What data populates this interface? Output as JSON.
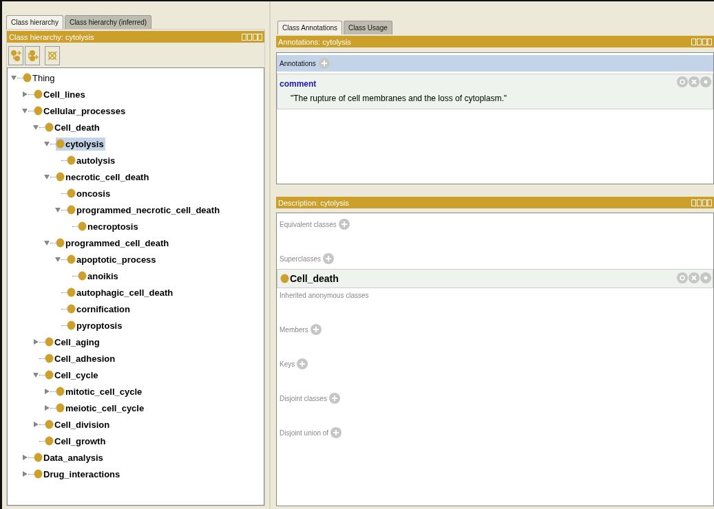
{
  "left_tabs": [
    {
      "label": "Class hierarchy",
      "selected": true
    },
    {
      "label": "Class hierarchy (inferred)",
      "selected": false
    }
  ],
  "hierarchy_view": {
    "title": "Class hierarchy: cytolysis",
    "tree": [
      {
        "label": "Thing",
        "expanded": true,
        "selected": false,
        "children": [
          {
            "label": "Cell_lines",
            "expanded": false,
            "selected": false
          },
          {
            "label": "Cellular_processes",
            "expanded": true,
            "selected": false,
            "children": [
              {
                "label": "Cell_death",
                "expanded": true,
                "selected": false,
                "children": [
                  {
                    "label": "cytolysis",
                    "expanded": true,
                    "selected": true,
                    "children": [
                      {
                        "label": "autolysis",
                        "selected": false
                      }
                    ]
                  },
                  {
                    "label": "necrotic_cell_death",
                    "expanded": true,
                    "selected": false,
                    "children": [
                      {
                        "label": "oncosis",
                        "selected": false
                      },
                      {
                        "label": "programmed_necrotic_cell_death",
                        "expanded": true,
                        "selected": false,
                        "children": [
                          {
                            "label": "necroptosis",
                            "selected": false
                          }
                        ]
                      }
                    ]
                  },
                  {
                    "label": "programmed_cell_death",
                    "expanded": true,
                    "selected": false,
                    "children": [
                      {
                        "label": "apoptotic_process",
                        "expanded": true,
                        "selected": false,
                        "children": [
                          {
                            "label": "anoikis",
                            "selected": false
                          }
                        ]
                      },
                      {
                        "label": "autophagic_cell_death",
                        "selected": false
                      },
                      {
                        "label": "cornification",
                        "selected": false
                      },
                      {
                        "label": "pyroptosis",
                        "selected": false
                      }
                    ]
                  }
                ]
              },
              {
                "label": "Cell_aging",
                "expanded": false,
                "selected": false
              },
              {
                "label": "Cell_adhesion",
                "selected": false
              },
              {
                "label": "Cell_cycle",
                "expanded": true,
                "selected": false,
                "children": [
                  {
                    "label": "mitotic_cell_cycle",
                    "expanded": false,
                    "selected": false
                  },
                  {
                    "label": "meiotic_cell_cycle",
                    "expanded": false,
                    "selected": false
                  }
                ]
              },
              {
                "label": "Cell_division",
                "expanded": false,
                "selected": false
              },
              {
                "label": "Cell_growth",
                "selected": false
              }
            ]
          },
          {
            "label": "Data_analysis",
            "expanded": false,
            "selected": false
          },
          {
            "label": "Drug_interactions",
            "expanded": false,
            "selected": false
          }
        ]
      }
    ]
  },
  "right_tabs": [
    {
      "label": "Class Annotations",
      "selected": true
    },
    {
      "label": "Class Usage",
      "selected": false
    }
  ],
  "annotations_view": {
    "title": "Annotations: cytolysis",
    "header": "Annotations",
    "items": [
      {
        "property": "comment",
        "value": "\"The rupture of cell membranes and the loss of cytoplasm.\""
      }
    ]
  },
  "description_view": {
    "title": "Description: cytolysis",
    "sections": [
      {
        "label": "Equivalent classes",
        "addable": true
      },
      {
        "label": "Superclasses",
        "addable": true,
        "items": [
          "Cell_death"
        ]
      },
      {
        "label": "Inherited anonymous classes",
        "addable": false
      },
      {
        "label": "Members",
        "addable": true
      },
      {
        "label": "Keys",
        "addable": true
      },
      {
        "label": "Disjoint classes",
        "addable": true
      },
      {
        "label": "Disjoint union of",
        "addable": true
      }
    ]
  }
}
